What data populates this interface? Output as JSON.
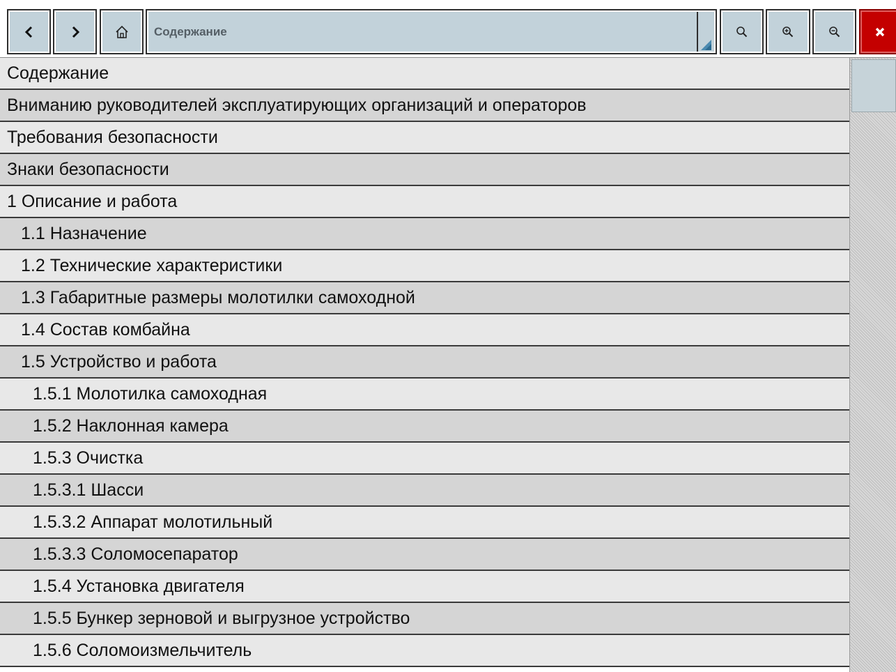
{
  "toolbar": {
    "back_icon": "chevron-left-icon",
    "forward_icon": "chevron-right-icon",
    "home_icon": "home-icon",
    "address_value": "Содержание",
    "search_icon": "magnifier-icon",
    "zoom_in_icon": "zoom-in-icon",
    "zoom_out_icon": "zoom-out-icon",
    "close_icon": "close-x-icon",
    "close_color": "#c40000",
    "button_color": "#c2d2da"
  },
  "toc": {
    "items": [
      {
        "label": "Содержание",
        "level": 0
      },
      {
        "label": "Вниманию руководителей эксплуатирующих организаций и операторов",
        "level": 0
      },
      {
        "label": "Требования безопасности",
        "level": 0
      },
      {
        "label": "Знаки безопасности",
        "level": 0
      },
      {
        "label": "1 Описание и работа",
        "level": 0
      },
      {
        "label": "1.1 Назначение",
        "level": 1
      },
      {
        "label": "1.2 Технические характеристики",
        "level": 1
      },
      {
        "label": "1.3 Габаритные размеры молотилки самоходной",
        "level": 1
      },
      {
        "label": "1.4 Состав комбайна",
        "level": 1
      },
      {
        "label": "1.5 Устройство и работа",
        "level": 1
      },
      {
        "label": "1.5.1 Молотилка самоходная",
        "level": 2
      },
      {
        "label": "1.5.2 Наклонная камера",
        "level": 2
      },
      {
        "label": "1.5.3 Очистка",
        "level": 2
      },
      {
        "label": "1.5.3.1 Шасси",
        "level": 2
      },
      {
        "label": "1.5.3.2 Аппарат молотильный",
        "level": 2
      },
      {
        "label": "1.5.3.3 Соломосепаратор",
        "level": 2
      },
      {
        "label": "1.5.4 Установка двигателя",
        "level": 2
      },
      {
        "label": "1.5.5 Бункер зерновой и выгрузное устройство",
        "level": 2
      },
      {
        "label": "1.5.6 Соломоизмельчитель",
        "level": 2
      }
    ]
  }
}
